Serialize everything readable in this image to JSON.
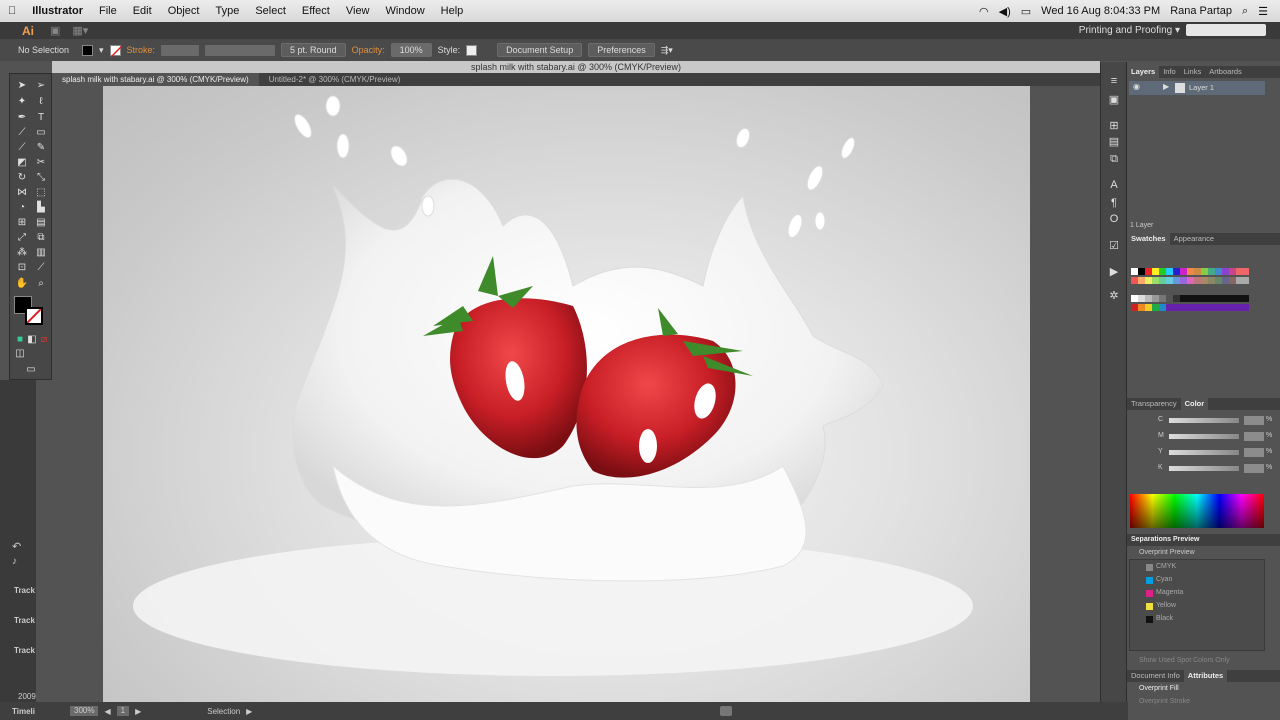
{
  "menubar": {
    "app_name": "Illustrator",
    "menus": [
      "File",
      "Edit",
      "Object",
      "Type",
      "Select",
      "Effect",
      "View",
      "Window",
      "Help"
    ],
    "datetime": "Wed 16 Aug  8:04:33 PM",
    "user": "Rana Partap"
  },
  "appbar": {
    "logo": "Ai",
    "workspace": "Printing and Proofing ▾"
  },
  "controlbar": {
    "selection": "No Selection",
    "stroke_label": "Stroke:",
    "brush": "5 pt. Round",
    "opacity_label": "Opacity:",
    "opacity_value": "100%",
    "style_label": "Style:",
    "document_setup": "Document Setup",
    "preferences": "Preferences"
  },
  "document": {
    "window_title": "splash milk with stabary.ai @ 300% (CMYK/Preview)",
    "tabs": [
      {
        "label": "splash milk with stabary.ai @ 300% (CMYK/Preview)",
        "active": true
      },
      {
        "label": "Untitled-2* @ 300% (CMYK/Preview)",
        "active": false
      }
    ]
  },
  "statusbar": {
    "zoom": "300%",
    "artboard": "1",
    "tool": "Selection"
  },
  "timeline": {
    "tracks": [
      "Track",
      "Track",
      "Track"
    ],
    "label": "Timeli",
    "year": "2009"
  },
  "layers_panel": {
    "tabs": [
      "Layers",
      "Info",
      "Links",
      "Artboards"
    ],
    "layer_name": "Layer 1",
    "count": "1 Layer"
  },
  "swatches_panel": {
    "tabs": [
      "Swatches",
      "Appearance"
    ]
  },
  "color_panel": {
    "tabs": [
      "Transparency",
      "Color"
    ],
    "channels": [
      "C",
      "M",
      "Y",
      "K"
    ],
    "percent": "%"
  },
  "separations_panel": {
    "title": "Separations Preview",
    "overprint_preview": "Overprint Preview",
    "plates": [
      "CMYK",
      "Cyan",
      "Magenta",
      "Yellow",
      "Black"
    ],
    "plate_colors": [
      "#888888",
      "#00a0e0",
      "#e0208a",
      "#f0e040",
      "#111111"
    ],
    "spot_only": "Show Used Spot Colors Only"
  },
  "attributes_panel": {
    "tabs": [
      "Document Info",
      "Attributes"
    ],
    "overprint_fill": "Overprint Fill",
    "overprint_stroke": "Overprint Stroke"
  },
  "colors": {
    "accent": "#e09040",
    "strawberry": "#c8202a",
    "leaf": "#3f8a2a"
  }
}
